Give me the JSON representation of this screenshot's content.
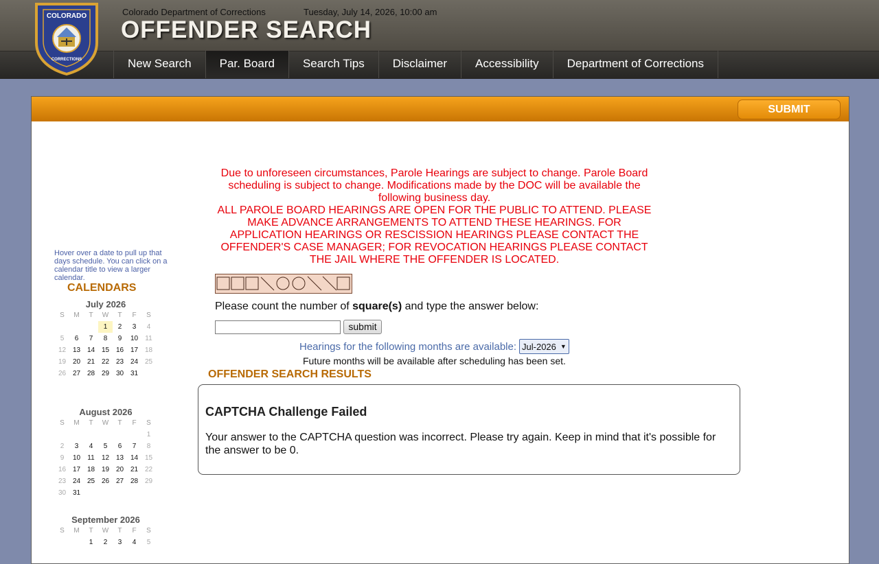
{
  "header": {
    "agency": "Colorado Department of Corrections",
    "datetime": "Tuesday, July 14, 2026, 10:00 am",
    "title": "OFFENDER SEARCH",
    "logo_text": "COLORADO DEPARTMENT OF CORRECTIONS"
  },
  "nav": {
    "items": [
      {
        "label": "New Search"
      },
      {
        "label": "Par. Board"
      },
      {
        "label": "Search Tips"
      },
      {
        "label": "Disclaimer"
      },
      {
        "label": "Accessibility"
      },
      {
        "label": "Department of Corrections"
      }
    ],
    "active_index": 1
  },
  "panel": {
    "submit_label": "SUBMIT"
  },
  "sidebar": {
    "hint": "Hover over a date to pull up that days schedule. You can click on a calendar title to view a larger calendar.",
    "heading": "CALENDARS",
    "calendars": [
      {
        "title": "July 2026",
        "dow": [
          "S",
          "M",
          "T",
          "W",
          "T",
          "F",
          "S"
        ],
        "weeks": [
          [
            "",
            "",
            "",
            "1",
            "2",
            "3",
            "4"
          ],
          [
            "5",
            "6",
            "7",
            "8",
            "9",
            "10",
            "11"
          ],
          [
            "12",
            "13",
            "14",
            "15",
            "16",
            "17",
            "18"
          ],
          [
            "19",
            "20",
            "21",
            "22",
            "23",
            "24",
            "25"
          ],
          [
            "26",
            "27",
            "28",
            "29",
            "30",
            "31",
            ""
          ]
        ],
        "highlight": "1"
      },
      {
        "title": "August 2026",
        "dow": [
          "S",
          "M",
          "T",
          "W",
          "T",
          "F",
          "S"
        ],
        "weeks": [
          [
            "",
            "",
            "",
            "",
            "",
            "",
            "1"
          ],
          [
            "2",
            "3",
            "4",
            "5",
            "6",
            "7",
            "8"
          ],
          [
            "9",
            "10",
            "11",
            "12",
            "13",
            "14",
            "15"
          ],
          [
            "16",
            "17",
            "18",
            "19",
            "20",
            "21",
            "22"
          ],
          [
            "23",
            "24",
            "25",
            "26",
            "27",
            "28",
            "29"
          ],
          [
            "30",
            "31",
            "",
            "",
            "",
            "",
            ""
          ]
        ],
        "highlight": ""
      },
      {
        "title": "September 2026",
        "dow": [
          "S",
          "M",
          "T",
          "W",
          "T",
          "F",
          "S"
        ],
        "weeks": [
          [
            "",
            "",
            "1",
            "2",
            "3",
            "4",
            "5"
          ]
        ],
        "highlight": ""
      }
    ]
  },
  "notice": {
    "line1": "Due to unforeseen circumstances, Parole Hearings are subject to change. Parole Board scheduling is subject to change. Modifications made by the DOC will be available the following business day.",
    "line2": "ALL PAROLE BOARD HEARINGS ARE OPEN FOR THE PUBLIC TO ATTEND. PLEASE MAKE ADVANCE ARRANGEMENTS TO ATTEND THESE HEARINGS. FOR APPLICATION HEARINGS OR RESCISSION HEARINGS PLEASE CONTACT THE OFFENDER'S CASE MANAGER; FOR REVOCATION HEARINGS PLEASE CONTACT THE JAIL WHERE THE OFFENDER IS LOCATED."
  },
  "captcha": {
    "question_pre": "Please count the number of ",
    "question_bold": "square(s)",
    "question_post": " and type the answer below:",
    "input_value": "",
    "submit_label": "submit",
    "shapes": [
      "square",
      "square",
      "square",
      "diagonal",
      "circle",
      "circle",
      "diagonal",
      "diagonal",
      "square"
    ]
  },
  "months": {
    "label": "Hearings for the following months are available:",
    "selected": "Jul-2026",
    "note": "Future months will be available after scheduling has been set."
  },
  "results": {
    "heading": "OFFENDER SEARCH RESULTS",
    "title": "CAPTCHA Challenge Failed",
    "message": "Your answer to the CAPTCHA question was incorrect. Please try again. Keep in mind that it's possible for the answer to be 0."
  },
  "colors": {
    "accent_orange": "#f6a31c",
    "heading_orange": "#b86a05",
    "notice_red": "#e8000b",
    "link_blue": "#4a5fa6",
    "page_bg": "#7f8aab"
  }
}
